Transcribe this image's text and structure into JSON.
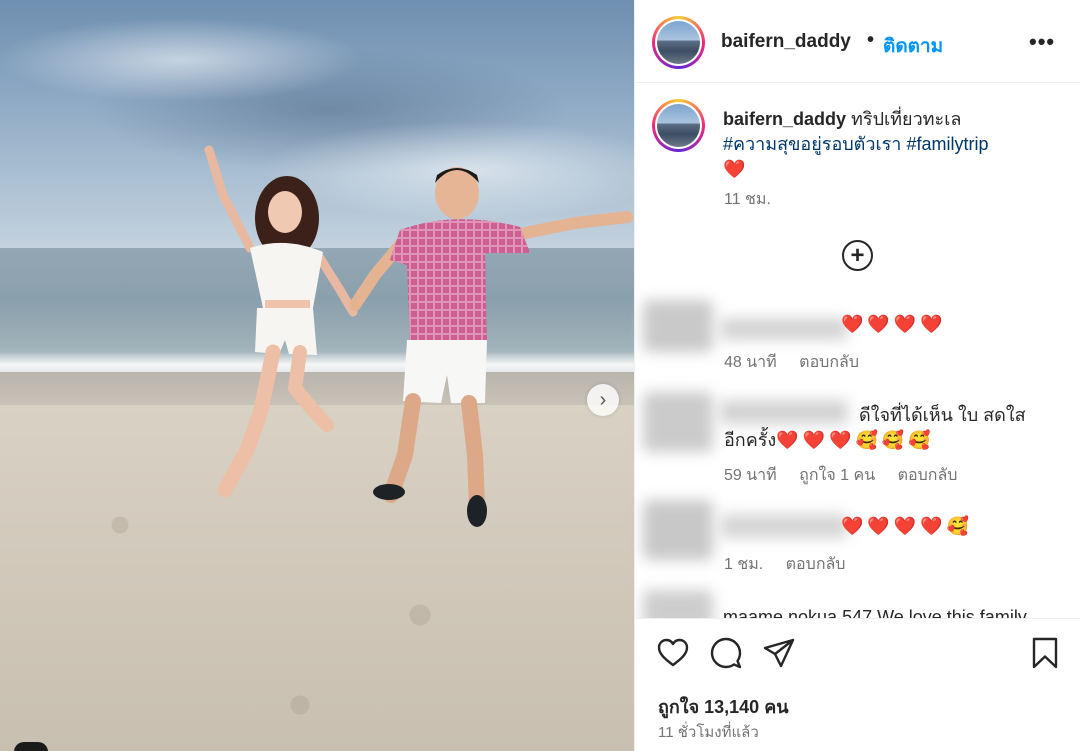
{
  "post": {
    "image_alt": "Couple jumping on a beach",
    "next_arrow": "›"
  },
  "header": {
    "username": "baifern_daddy",
    "separator": "•",
    "follow_label": "ติดตาม",
    "more_label": "•••"
  },
  "caption": {
    "username": "baifern_daddy",
    "text": "ทริปเที่ยวทะเล",
    "hashtag1": "#ความสุขอยู่รอบตัวเรา",
    "hashtag2": "#familytrip",
    "emoji": "❤️",
    "time": "11 ชม."
  },
  "load_more_label": "+",
  "comments": [
    {
      "text": "❤️❤️❤️❤️",
      "time": "48 นาที",
      "reply_label": "ตอบกลับ"
    },
    {
      "line1": "ดีใจที่ได้เห็น ใบ สดใส",
      "line2": "อีกครั้ง",
      "emoji": "❤️❤️❤️🥰🥰🥰",
      "time": "59 นาที",
      "likes_label": "ถูกใจ 1 คน",
      "reply_label": "ตอบกลับ"
    },
    {
      "text": "❤️❤️❤️❤️🥰",
      "time": "1 ชม.",
      "reply_label": "ตอบกลับ"
    },
    {
      "text": "maame.nokua.547 We love this family"
    }
  ],
  "actions": {
    "like_icon": "heart-icon",
    "comment_icon": "comment-icon",
    "share_icon": "share-icon",
    "save_icon": "bookmark-icon"
  },
  "likes_label": "ถูกใจ 13,140 คน",
  "posted_ago": "11 ชั่วโมงที่แล้ว"
}
